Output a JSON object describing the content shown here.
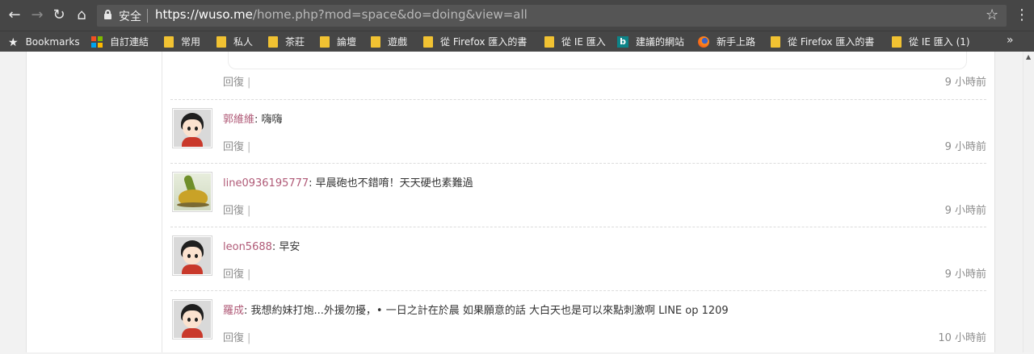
{
  "browser": {
    "secure_label": "安全",
    "url_host": "https://wuso.me",
    "url_path": "/home.php?mod=space&do=doing&view=all"
  },
  "bookmarks": [
    {
      "label": "Bookmarks",
      "icon": "star-icon"
    },
    {
      "label": "自訂連結",
      "icon": "microsoft-icon"
    },
    {
      "label": "常用",
      "icon": "folder-icon"
    },
    {
      "label": "私人",
      "icon": "folder-icon"
    },
    {
      "label": "茶莊",
      "icon": "folder-icon"
    },
    {
      "label": "論壇",
      "icon": "folder-icon"
    },
    {
      "label": "遊戲",
      "icon": "folder-icon"
    },
    {
      "label": "從 Firefox 匯入的書",
      "icon": "folder-icon"
    },
    {
      "label": "從 IE 匯入",
      "icon": "folder-icon"
    },
    {
      "label": "建議的網站",
      "icon": "bing-icon"
    },
    {
      "label": "新手上路",
      "icon": "firefox-icon"
    },
    {
      "label": "從 Firefox 匯入的書",
      "icon": "folder-icon"
    },
    {
      "label": "從 IE 匯入 (1)",
      "icon": "folder-icon"
    }
  ],
  "entries": [
    {
      "user": "",
      "text": "",
      "reply": "回復",
      "time": "9 小時前",
      "avatar": "none"
    },
    {
      "user": "郭維維",
      "text": ": 嗨嗨",
      "reply": "回復",
      "time": "9 小時前",
      "avatar": "boy-avatar"
    },
    {
      "user": "line0936195777",
      "text": ": 早晨砲也不錯唷！天天硬也素難過",
      "reply": "回復",
      "time": "9 小時前",
      "avatar": "banana-avatar"
    },
    {
      "user": "leon5688",
      "text": ": 早安",
      "reply": "回復",
      "time": "9 小時前",
      "avatar": "boy-avatar"
    },
    {
      "user": "羅成",
      "text": ": 我想約妹打炮...外援勿擾，• 一日之計在於晨 如果願意的話 大白天也是可以來點刺激啊 LINE op 1209",
      "reply": "回復",
      "time": "10 小時前",
      "avatar": "boy-avatar"
    }
  ]
}
